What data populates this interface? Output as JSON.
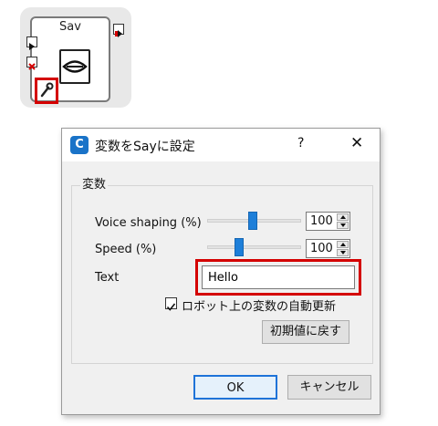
{
  "box": {
    "title": "Sav"
  },
  "dialog": {
    "title": "変数をSayに設定",
    "help_label": "?",
    "close_label": "✕",
    "app_icon_letter": "C",
    "group_label": "変数",
    "voice_shaping": {
      "label": "Voice shaping (%)",
      "value": "100",
      "slider_fraction": 0.5
    },
    "speed": {
      "label": "Speed (%)",
      "value": "100",
      "slider_fraction": 0.33
    },
    "text": {
      "label": "Text",
      "value": "Hello"
    },
    "auto_update": {
      "label": "ロボット上の変数の自動更新",
      "checked": true
    },
    "reset_label": "初期値に戻す",
    "ok_label": "OK",
    "cancel_label": "キャンセル"
  },
  "colors": {
    "highlight": "#d40000",
    "accent": "#1e7fd9"
  },
  "icons": [
    "play-input-icon",
    "stop-input-icon",
    "output-icon",
    "lips-icon",
    "wrench-icon",
    "app-c-icon",
    "close-icon",
    "help-icon",
    "checkmark-icon"
  ]
}
